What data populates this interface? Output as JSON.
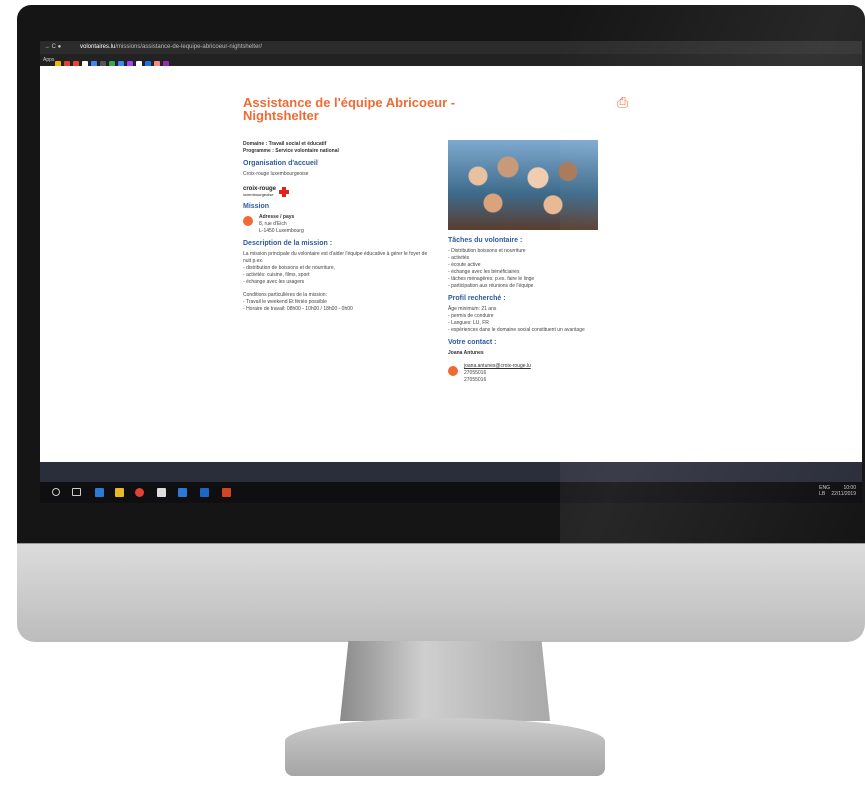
{
  "browser": {
    "url_domain": "volontaires.lu",
    "url_path": "/missions/assistance-de-lequipe-abricoeur-nightshelter/",
    "apps_label": "Apps"
  },
  "page": {
    "title": "Assistance de l'équipe Abricoeur - Nightshelter",
    "domaine_label": "Domaine :",
    "domaine_value": "Travail social et éducatif",
    "programme_label": "Programme :",
    "programme_value": "Service volontaire national",
    "org_heading": "Organisation d'accueil",
    "org_name": "Croix-rouge luxembourgeoise",
    "logo_text_1": "croix-rouge",
    "logo_text_2": "luxembourgeoise",
    "mission_heading": "Mission",
    "address_label": "Adresse / pays",
    "address_line1": "8, rue d'Eich",
    "address_line2": "L-1450 Luxembourg",
    "description_heading": "Description de la mission :",
    "description_text": "La mission principale du volontaire est d'aider l'équipe éducative à gérer le foyer de nuit p.ex.",
    "description_items": [
      "distribution de boissons et de nourriture,",
      "activités: cuisine, films, sport",
      "échange avec les usagers"
    ],
    "conditions_title": "Conditions particulières de la mission:",
    "conditions_items": [
      "Travail le weekend Et fériés possible",
      "Horaire de travail: 08h00 - 10h00 / 18h00 - 0h00"
    ],
    "taches_heading": "Tâches du volontaire :",
    "taches_items": [
      "Distribution boissons et nourriture",
      "activités",
      "écoute active",
      "échange avec les bénéficiaires",
      "tâches ménagères: p.ex. faire le linge",
      "participation aux réunions de l'équipe"
    ],
    "profil_heading": "Profil recherché :",
    "profil_age": "Âge minimum: 21 ans",
    "profil_items": [
      "permis de conduire",
      "Langues: LU, FR",
      "expériences dans le domaine social constituent un avantage"
    ],
    "contact_heading": "Votre contact :",
    "contact_name": "Joana Antunes",
    "contact_email": "joana.antunes@croix-rouge.lu",
    "contact_phone1": "27055016",
    "contact_phone2": "27055016"
  },
  "taskbar": {
    "lang_top": "ENG",
    "lang_bottom": "LB",
    "time": "10:00",
    "date": "22/11/2019"
  },
  "colors": {
    "accent": "#ef6b35",
    "heading": "#2c5aa0"
  }
}
